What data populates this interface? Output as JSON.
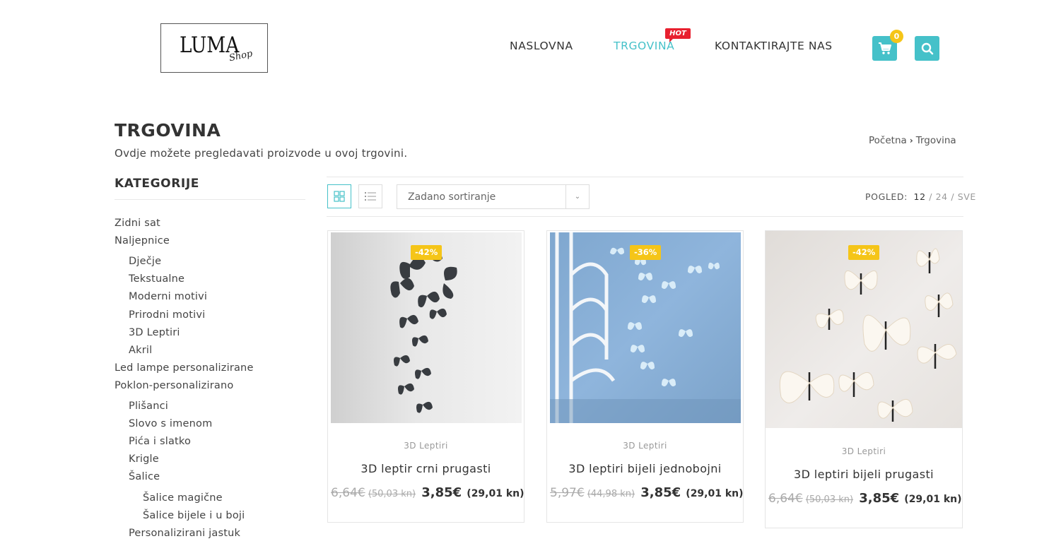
{
  "brand": {
    "logo_text": "LUMA",
    "logo_script": "Shop"
  },
  "nav": {
    "items": [
      {
        "label": "NASLOVNA"
      },
      {
        "label": "TRGOVINA",
        "badge": "HOT"
      },
      {
        "label": "KONTAKTIRAJTE NAS"
      }
    ],
    "cart_count": "0",
    "accent_color": "#45c1c9"
  },
  "page": {
    "title": "TRGOVINA",
    "description": "Ovdje možete pregledavati proizvode u ovoj trgovini.",
    "breadcrumb": [
      "Početna",
      "Trgovina"
    ]
  },
  "sidebar": {
    "title": "KATEGORIJE",
    "categories": [
      {
        "label": "Zidni sat",
        "level": 0
      },
      {
        "label": "Naljepnice",
        "level": 0
      },
      {
        "label": "Dječje",
        "level": 1
      },
      {
        "label": "Tekstualne",
        "level": 1
      },
      {
        "label": "Moderni motivi",
        "level": 1
      },
      {
        "label": "Prirodni motivi",
        "level": 1
      },
      {
        "label": "3D Leptiri",
        "level": 1
      },
      {
        "label": "Akril",
        "level": 1
      },
      {
        "label": "Led lampe personalizirane",
        "level": 0
      },
      {
        "label": "Poklon-personalizirano",
        "level": 0
      },
      {
        "label": "Plišanci",
        "level": 1
      },
      {
        "label": "Slovo s imenom",
        "level": 1
      },
      {
        "label": "Pića i slatko",
        "level": 1
      },
      {
        "label": "Krigle",
        "level": 1
      },
      {
        "label": "Šalice",
        "level": 1
      },
      {
        "label": "Šalice magične",
        "level": 2
      },
      {
        "label": "Šalice bijele i u boji",
        "level": 2
      },
      {
        "label": "Personalizirani jastuk",
        "level": 1
      }
    ]
  },
  "toolbar": {
    "sort_value": "Zadano sortiranje",
    "view_label": "POGLED:",
    "view_current": "12",
    "view_options": [
      "24",
      "SVE"
    ]
  },
  "products": [
    {
      "discount": "-42%",
      "category": "3D Leptiri",
      "name": "3D leptir crni prugasti",
      "old_price": "6,64€",
      "old_price_kn": "(50,03 kn)",
      "price": "3,85€",
      "price_kn": "(29,01 kn)"
    },
    {
      "discount": "-36%",
      "category": "3D Leptiri",
      "name": "3D leptiri bijeli jednobojni",
      "old_price": "5,97€",
      "old_price_kn": "(44,98 kn)",
      "price": "3,85€",
      "price_kn": "(29,01 kn)"
    },
    {
      "discount": "-42%",
      "category": "3D Leptiri",
      "name": "3D leptiri bijeli prugasti",
      "old_price": "6,64€",
      "old_price_kn": "(50,03 kn)",
      "price": "3,85€",
      "price_kn": "(29,01 kn)"
    }
  ]
}
